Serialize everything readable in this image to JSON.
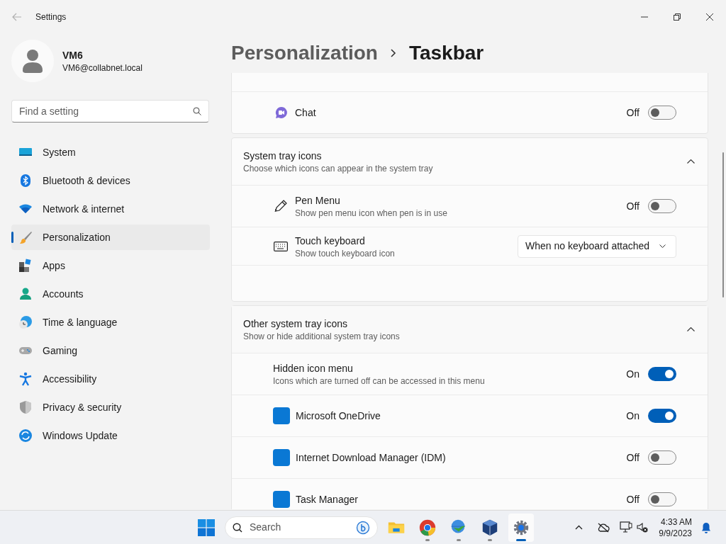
{
  "window": {
    "title": "Settings"
  },
  "user": {
    "name": "VM6",
    "email": "VM6@collabnet.local"
  },
  "search": {
    "placeholder": "Find a setting"
  },
  "sidebar": {
    "items": [
      {
        "label": "System",
        "selected": false
      },
      {
        "label": "Bluetooth & devices",
        "selected": false
      },
      {
        "label": "Network & internet",
        "selected": false
      },
      {
        "label": "Personalization",
        "selected": true
      },
      {
        "label": "Apps",
        "selected": false
      },
      {
        "label": "Accounts",
        "selected": false
      },
      {
        "label": "Time & language",
        "selected": false
      },
      {
        "label": "Gaming",
        "selected": false
      },
      {
        "label": "Accessibility",
        "selected": false
      },
      {
        "label": "Privacy & security",
        "selected": false
      },
      {
        "label": "Windows Update",
        "selected": false
      }
    ]
  },
  "breadcrumb": [
    "Personalization",
    "Taskbar"
  ],
  "sections": [
    {
      "rows": [
        {
          "kind": "toggle",
          "label": "Chat",
          "state_label": "Off",
          "on": false
        }
      ]
    },
    {
      "title": "System tray icons",
      "description": "Choose which icons can appear in the system tray",
      "expanded": true,
      "rows": [
        {
          "kind": "toggle",
          "label": "Pen Menu",
          "description": "Show pen menu icon when pen is in use",
          "state_label": "Off",
          "on": false
        },
        {
          "kind": "dropdown",
          "label": "Touch keyboard",
          "description": "Show touch keyboard icon",
          "value": "When no keyboard attached"
        }
      ]
    },
    {
      "title": "Other system tray icons",
      "description": "Show or hide additional system tray icons",
      "expanded": true,
      "rows": [
        {
          "kind": "toggle",
          "label": "Hidden icon menu",
          "description": "Icons which are turned off can be accessed in this menu",
          "state_label": "On",
          "on": true
        },
        {
          "kind": "toggle",
          "label": "Microsoft OneDrive",
          "state_label": "On",
          "on": true
        },
        {
          "kind": "toggle",
          "label": "Internet Download Manager (IDM)",
          "state_label": "Off",
          "on": false
        },
        {
          "kind": "toggle",
          "label": "Task Manager",
          "state_label": "Off",
          "on": false
        }
      ]
    }
  ],
  "taskbar": {
    "search_placeholder": "Search",
    "apps": [
      {
        "kind": "folder",
        "running": false,
        "selected": false
      },
      {
        "kind": "browser",
        "running": true,
        "selected": false
      },
      {
        "kind": "download",
        "running": true,
        "selected": false
      },
      {
        "kind": "cube",
        "running": true,
        "selected": false
      },
      {
        "kind": "gear",
        "running": true,
        "selected": true
      }
    ],
    "time": "4:33 AM",
    "date": "9/9/2023"
  }
}
